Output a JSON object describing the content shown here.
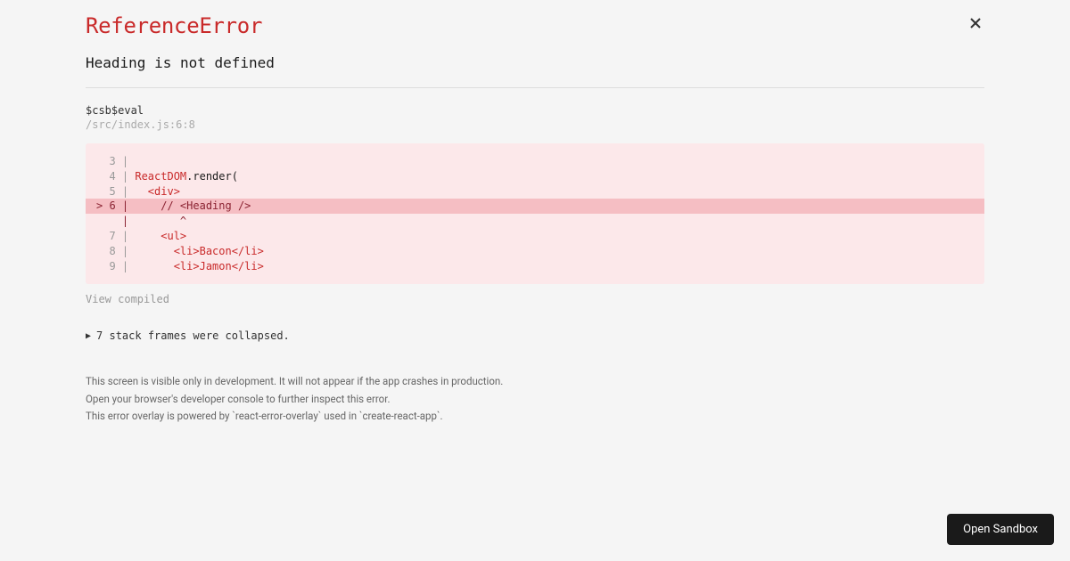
{
  "error": {
    "type": "ReferenceError",
    "message": "Heading is not defined"
  },
  "stack": {
    "function": "$csb$eval",
    "location": "/src/index.js:6:8"
  },
  "code": {
    "line3": "  3 | ",
    "line4_ln": "  4 | ",
    "line4_kw": "ReactDOM",
    "line4_rest": ".render(",
    "line5_ln": "  5 |   ",
    "line5_rest": "<div>",
    "line6": "> 6 |     // <Heading />",
    "caret": "    |        ^",
    "line7_ln": "  7 |     ",
    "line7_rest": "<ul>",
    "line8_ln": "  8 |       ",
    "line8_rest": "<li>Bacon</li>",
    "line9_ln": "  9 |       ",
    "line9_rest": "<li>Jamon</li>"
  },
  "view_compiled": "View compiled",
  "collapsed": "7 stack frames were collapsed.",
  "footer": {
    "line1": "This screen is visible only in development. It will not appear if the app crashes in production.",
    "line2": "Open your browser's developer console to further inspect this error.",
    "line3": "This error overlay is powered by `react-error-overlay` used in `create-react-app`."
  },
  "open_sandbox": "Open Sandbox"
}
